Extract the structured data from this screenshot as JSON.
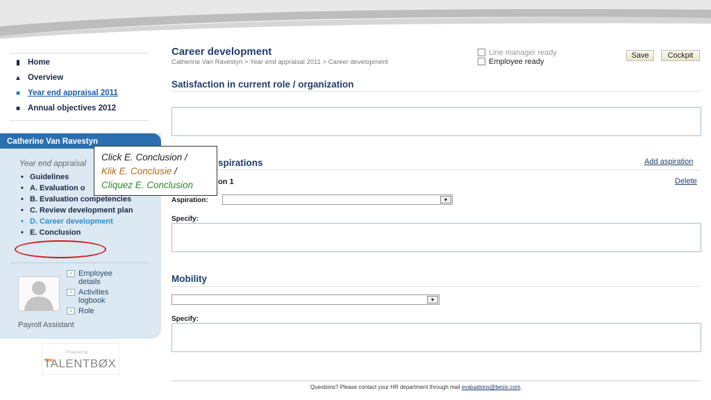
{
  "nav": {
    "items": [
      {
        "label": "Home",
        "icon": "house-icon",
        "glyph": "▮"
      },
      {
        "label": "Overview",
        "icon": "person-icon",
        "glyph": "▲"
      },
      {
        "label": "Year end appraisal 2011",
        "icon": "square-icon",
        "glyph": "■",
        "active": true
      },
      {
        "label": "Annual objectives 2012",
        "icon": "square-icon",
        "glyph": "■"
      }
    ]
  },
  "panel": {
    "user_name": "Catherine Van Ravestyn",
    "subtitle": "Year end appraisal",
    "steps": [
      "Guidelines",
      "A. Evaluation o",
      "B. Evaluation competencies",
      "C. Review development plan",
      "D. Career development",
      "E. Conclusion"
    ],
    "links": [
      "Employee details",
      "Activities logbook",
      "Role"
    ],
    "role": "Payroll Assistant"
  },
  "logo": {
    "powered": "Powered by",
    "the": "THE",
    "name": "TALENTBØX"
  },
  "header": {
    "title": "Career development",
    "breadcrumb": "Catherine Van Ravestyn > Year end appraisal 2011 > Career development",
    "checkbox_line_manager": "Line manager ready",
    "checkbox_employee": "Employee ready",
    "save_label": "Save",
    "cockpit_label": "Cockpit"
  },
  "satisfaction": {
    "title": "Satisfaction in current role / organization"
  },
  "aspirations": {
    "title_partial": "spirations",
    "add_label": "Add aspiration",
    "item_partial": "on 1",
    "delete_label": "Delete",
    "aspiration_label": "Aspiration:",
    "specify_label": "Specify:"
  },
  "mobility": {
    "title": "Mobility",
    "specify_label": "Specify:"
  },
  "footer": {
    "text": "Questions? Please contact your HR department through mail ",
    "email": "evaluations@besix.com",
    "end": "."
  },
  "callout": {
    "line1": "Click E. Conclusion /",
    "line2": "Klik E. Conclusie",
    "line2_sep": " /",
    "line3": "Cliquez E. Conclusion"
  }
}
